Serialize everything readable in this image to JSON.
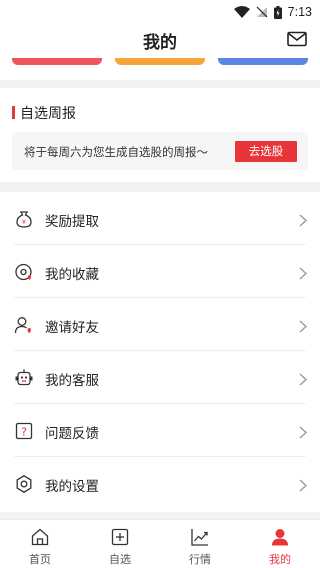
{
  "status_bar": {
    "time": "7:13"
  },
  "header": {
    "title": "我的"
  },
  "cards": [
    {
      "color": "#f0555b"
    },
    {
      "color": "#f5a53a"
    },
    {
      "color": "#5b86e5"
    }
  ],
  "weekly": {
    "title": "自选周报",
    "text": "将于每周六为您生成自选股的周报～",
    "button": "去选股"
  },
  "menu": [
    {
      "label": "奖励提取",
      "icon": "money-bag-icon"
    },
    {
      "label": "我的收藏",
      "icon": "favorite-icon"
    },
    {
      "label": "邀请好友",
      "icon": "invite-user-icon"
    },
    {
      "label": "我的客服",
      "icon": "robot-service-icon"
    },
    {
      "label": "问题反馈",
      "icon": "feedback-icon"
    },
    {
      "label": "我的设置",
      "icon": "settings-gear-icon"
    }
  ],
  "nav": [
    {
      "label": "首页",
      "icon": "home-icon",
      "active": false
    },
    {
      "label": "自选",
      "icon": "add-watchlist-icon",
      "active": false
    },
    {
      "label": "行情",
      "icon": "market-chart-icon",
      "active": false
    },
    {
      "label": "我的",
      "icon": "profile-icon",
      "active": true
    }
  ],
  "colors": {
    "accent": "#e8353a"
  }
}
